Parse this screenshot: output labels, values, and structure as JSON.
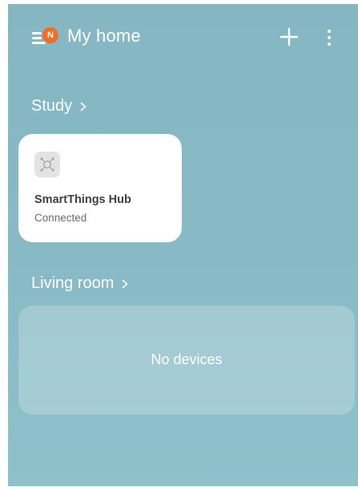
{
  "header": {
    "title": "My home",
    "notification_badge": "N",
    "menu_icon": "hamburger-menu-icon",
    "add_icon": "plus-icon",
    "more_icon": "vertical-dots-icon"
  },
  "rooms": [
    {
      "name": "Study",
      "devices": [
        {
          "name": "SmartThings Hub",
          "status": "Connected",
          "icon": "hub-icon"
        }
      ]
    },
    {
      "name": "Living room",
      "empty_label": "No devices"
    }
  ],
  "colors": {
    "background": "#87bac5",
    "badge": "#f26d21",
    "card": "#ffffff"
  }
}
